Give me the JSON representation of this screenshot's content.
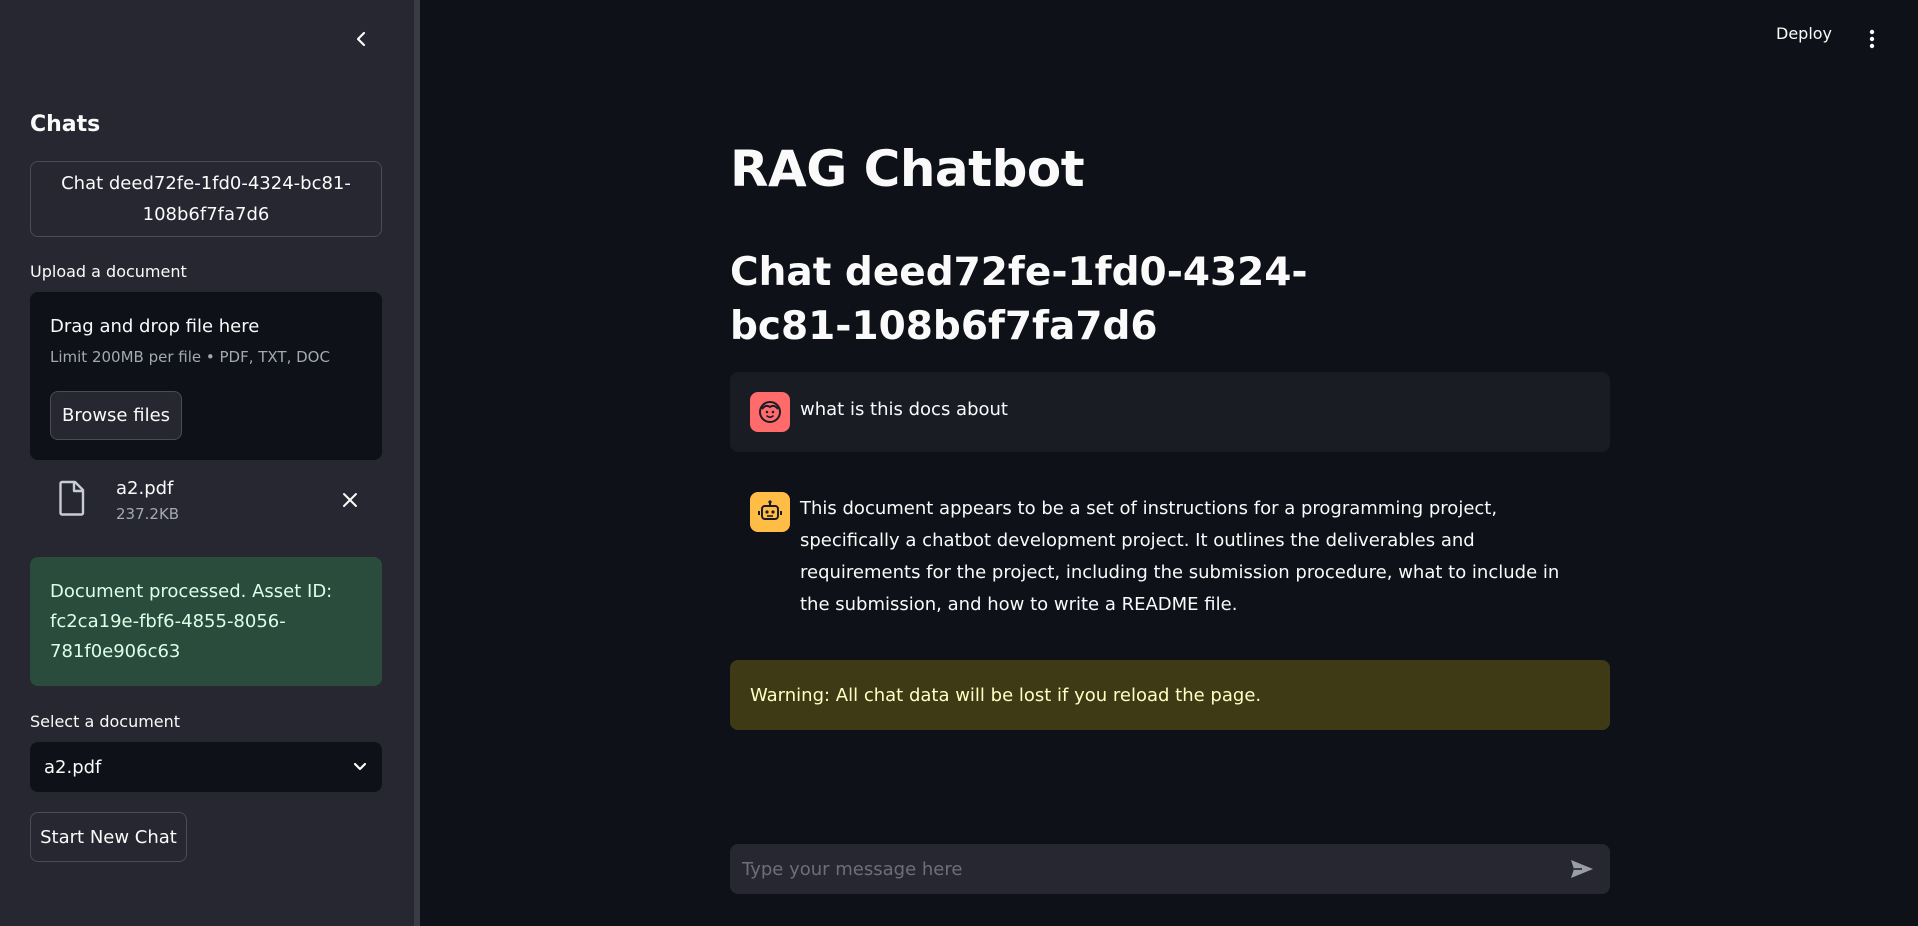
{
  "header": {
    "deploy_label": "Deploy"
  },
  "sidebar": {
    "heading": "Chats",
    "chats": [
      {
        "label": "Chat deed72fe-1fd0-4324-bc81-108b6f7fa7d6"
      }
    ],
    "upload": {
      "label": "Upload a document",
      "drop_title": "Drag and drop file here",
      "limit_text": "Limit 200MB per file • PDF, TXT, DOC",
      "browse_label": "Browse files"
    },
    "uploaded_file": {
      "name": "a2.pdf",
      "size": "237.2KB"
    },
    "success_message": "Document processed. Asset ID: fc2ca19e-fbf6-4855-8056-781f0e906c63",
    "select": {
      "label": "Select a document",
      "value": "a2.pdf"
    },
    "new_chat_label": "Start New Chat"
  },
  "main": {
    "title": "RAG Chatbot",
    "chat_title": "Chat deed72fe-1fd0-4324-bc81-108b6f7fa7d6",
    "messages": [
      {
        "role": "user",
        "text": "what is this docs about"
      },
      {
        "role": "assistant",
        "text": "This document appears to be a set of instructions for a programming project, specifically a chatbot development project. It outlines the deliverables and requirements for the project, including the submission procedure, what to include in the submission, and how to write a README file."
      }
    ],
    "warning": "Warning: All chat data will be lost if you reload the page.",
    "input": {
      "placeholder": "Type your message here",
      "value": ""
    }
  },
  "colors": {
    "background": "#0e1117",
    "sidebar": "#262730",
    "success_bg": "#2a4c3c",
    "warning_bg": "#3e3a16",
    "user_avatar": "#ff6b6b",
    "bot_avatar": "#ffbd45"
  },
  "icons": [
    "chevron-left-icon",
    "kebab-menu-icon",
    "file-icon",
    "close-icon",
    "chevron-down-icon",
    "user-face-icon",
    "robot-icon",
    "send-icon"
  ]
}
